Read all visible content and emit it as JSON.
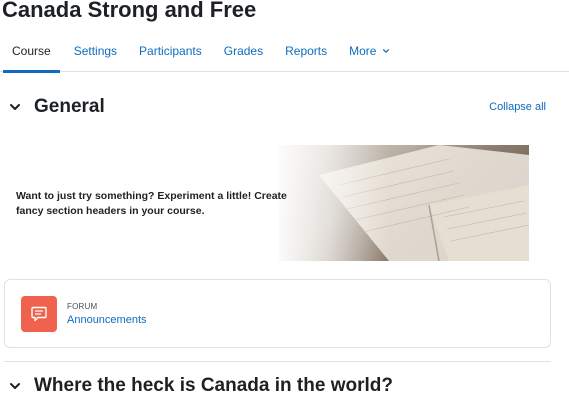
{
  "page": {
    "title": "Canada Strong and Free"
  },
  "tabs": [
    {
      "label": "Course",
      "active": true
    },
    {
      "label": "Settings"
    },
    {
      "label": "Participants"
    },
    {
      "label": "Grades"
    },
    {
      "label": "Reports"
    },
    {
      "label": "More"
    }
  ],
  "sections": {
    "general": {
      "title": "General"
    },
    "second": {
      "title": "Where the heck is Canada in the world?"
    },
    "collapse_all": "Collapse all"
  },
  "banner": {
    "text": "Want to just try something? Experiment a little! Create fancy section headers in your course."
  },
  "activity": {
    "type": "FORUM",
    "name": "Announcements",
    "icon": "forum-icon",
    "icon_color": "#f0624d"
  },
  "colors": {
    "accent": "#0f6cbf",
    "text": "#1d2125"
  }
}
